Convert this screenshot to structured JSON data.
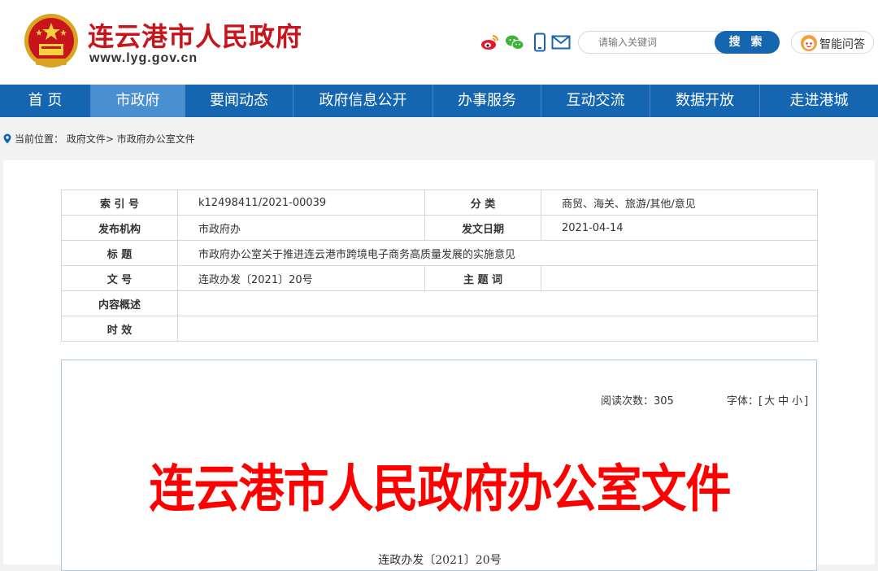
{
  "header": {
    "site_title": "连云港市人民政府",
    "site_url": "www.lyg.gov.cn",
    "icons": [
      "weibo-icon",
      "wechat-icon",
      "mobile-icon",
      "mail-icon"
    ],
    "search": {
      "placeholder": "请输入关键词",
      "button_label": "搜 索"
    },
    "qa_label": "智能问答"
  },
  "nav": {
    "active_index": 1,
    "items": [
      "首 页",
      "市政府",
      "要闻动态",
      "政府信息公开",
      "办事服务",
      "互动交流",
      "数据开放",
      "走进港城"
    ]
  },
  "breadcrumb": {
    "prefix": "当前位置：",
    "items": [
      "政府文件",
      "市政府办公室文件"
    ],
    "separator": ">"
  },
  "meta": {
    "index_label": "索 引 号",
    "index_value": "k12498411/2021-00039",
    "category_label": "分 类",
    "category_value": "商贸、海关、旅游/其他/意见",
    "publisher_label": "发布机构",
    "publisher_value": "市政府办",
    "date_label": "发文日期",
    "date_value": "2021-04-14",
    "title_label": "标 题",
    "title_value": "市政府办公室关于推进连云港市跨境电子商务高质量发展的实施意见",
    "docno_label": "文 号",
    "docno_value": "连政办发〔2021〕20号",
    "subject_label": "主 题 词",
    "subject_value": "",
    "summary_label": "内容概述",
    "summary_value": "",
    "validity_label": "时 效",
    "validity_value": ""
  },
  "document": {
    "read_count_label": "阅读次数：",
    "read_count": "305",
    "font_label": "字体：",
    "font_sizes": [
      "大",
      "中",
      "小"
    ],
    "header_title": "连云港市人民政府办公室文件",
    "doc_number": "连政办发〔2021〕20号"
  },
  "colors": {
    "brand_red": "#c8141b",
    "nav_blue": "#1566b0",
    "nav_active": "#4a8fd0",
    "doc_red": "#ff0000"
  }
}
